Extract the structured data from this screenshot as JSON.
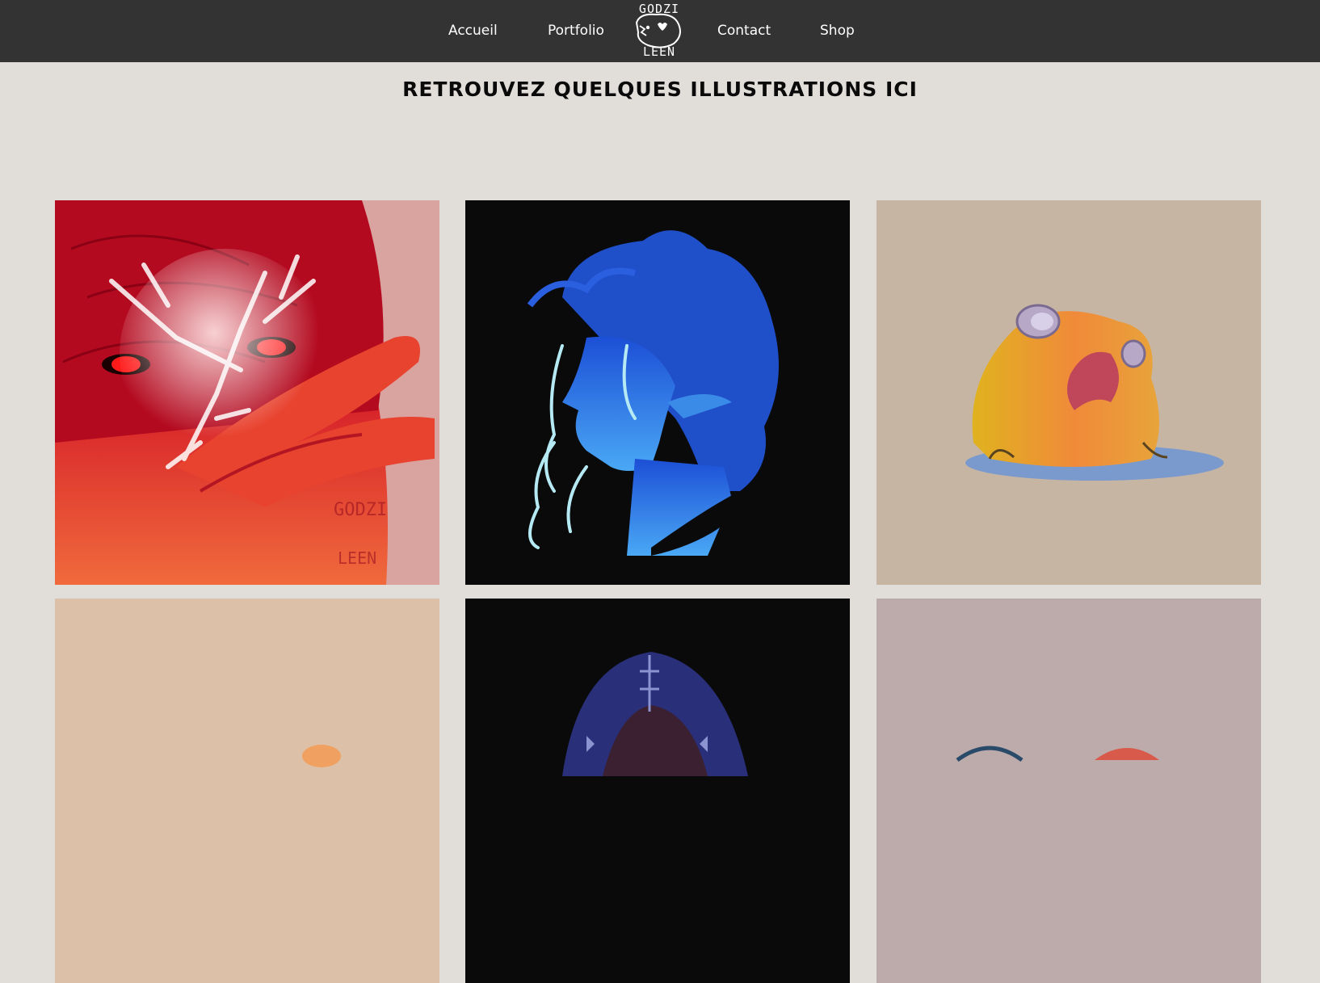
{
  "nav": {
    "items": [
      {
        "label": "Accueil"
      },
      {
        "label": "Portfolio"
      },
      {
        "label": "Contact"
      },
      {
        "label": "Shop"
      }
    ],
    "logo": {
      "lines": [
        "GODZI",
        "LEEN"
      ],
      "icon": "godzi-leen-logo-icon"
    }
  },
  "page": {
    "title": "RETROUVEZ QUELQUES ILLUSTRATIONS ICI"
  },
  "gallery": {
    "items": [
      {
        "subject": "red-haired-character-illustration",
        "background": "#c8102e"
      },
      {
        "subject": "blue-elf-profile-illustration",
        "background": "#0a0a0a"
      },
      {
        "subject": "yellow-frog-illustration",
        "background": "#c7b5a4"
      },
      {
        "subject": "orange-creature-illustration",
        "background": "#dcc1a8"
      },
      {
        "subject": "hooded-figure-illustration",
        "background": "#0a0a0a"
      },
      {
        "subject": "pink-creatures-illustration",
        "background": "#bdaaaa"
      }
    ],
    "watermark": [
      "GODZI",
      "LEEN"
    ]
  },
  "colors": {
    "navbar": "#333333",
    "page_background": "#e1deda",
    "title_text": "#0a0a0a",
    "nav_text": "#ffffff"
  }
}
